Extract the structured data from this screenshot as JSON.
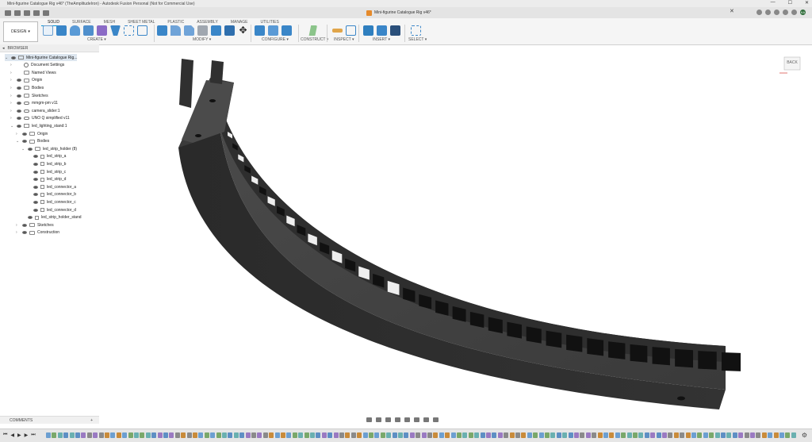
{
  "window": {
    "title": "Mini-figurine Catalogue Rig v46* (TheAmplitudeIron) - Autodesk Fusion Personal (Not for Commercial Use)",
    "controls": [
      "—",
      "☐",
      "✕"
    ]
  },
  "document_tab": {
    "title": "Mini-figurine Catalogue Rig v46*",
    "close": "✕",
    "account_initials": "KA"
  },
  "ribbon": {
    "workspace": "DESIGN",
    "tabs": [
      "SOLID",
      "SURFACE",
      "MESH",
      "SHEET METAL",
      "PLASTIC",
      "ASSEMBLY",
      "MANAGE",
      "UTILITIES"
    ],
    "active_tab": "SOLID",
    "groups": [
      "CREATE ▾",
      "MODIFY ▾",
      "CONFIGURE ▾",
      "CONSTRUCT ▾",
      "INSPECT ▾",
      "INSERT ▾",
      "SELECT ▾"
    ],
    "colors": {
      "accent": "#0696d7",
      "create": "#3a86c8",
      "insert": "#2f7fbf"
    }
  },
  "browser": {
    "title": "BROWSER",
    "items": [
      {
        "label": "Mini-figurine Catalogue Rig...",
        "level": 0,
        "kind": "root",
        "caret": "⌄",
        "eye": true
      },
      {
        "label": "Document Settings",
        "level": 1,
        "kind": "settings",
        "caret": "›",
        "eye": false
      },
      {
        "label": "Named Views",
        "level": 1,
        "kind": "folder",
        "caret": "›",
        "eye": false
      },
      {
        "label": "Origin",
        "level": 1,
        "kind": "folder",
        "caret": "›",
        "eye": true
      },
      {
        "label": "Bodies",
        "level": 1,
        "kind": "folder",
        "caret": "›",
        "eye": true
      },
      {
        "label": "Sketches",
        "level": 1,
        "kind": "folder",
        "caret": "›",
        "eye": true
      },
      {
        "label": "mmgm-pm v11",
        "level": 1,
        "kind": "link",
        "caret": "›",
        "eye": true
      },
      {
        "label": "camera_slider:1",
        "level": 1,
        "kind": "link",
        "caret": "›",
        "eye": true
      },
      {
        "label": "UNO Q simplified v11",
        "level": 1,
        "kind": "link",
        "caret": "›",
        "eye": true
      },
      {
        "label": "led_lighting_stand:1",
        "level": 1,
        "kind": "component",
        "caret": "⌄",
        "eye": true
      },
      {
        "label": "Origin",
        "level": 2,
        "kind": "folder",
        "caret": "›",
        "eye": true
      },
      {
        "label": "Bodies",
        "level": 2,
        "kind": "folder",
        "caret": "⌄",
        "eye": true
      },
      {
        "label": "led_strip_holder (8)",
        "level": 3,
        "kind": "folder",
        "caret": "⌄",
        "eye": true
      },
      {
        "label": "led_strip_a",
        "level": 4,
        "kind": "body",
        "caret": "",
        "eye": true
      },
      {
        "label": "led_strip_b",
        "level": 4,
        "kind": "body",
        "caret": "",
        "eye": true
      },
      {
        "label": "led_strip_c",
        "level": 4,
        "kind": "body",
        "caret": "",
        "eye": true
      },
      {
        "label": "led_strip_d",
        "level": 4,
        "kind": "body",
        "caret": "",
        "eye": true
      },
      {
        "label": "led_connector_a",
        "level": 4,
        "kind": "body",
        "caret": "",
        "eye": true
      },
      {
        "label": "led_connector_b",
        "level": 4,
        "kind": "body",
        "caret": "",
        "eye": true
      },
      {
        "label": "led_connector_c",
        "level": 4,
        "kind": "body",
        "caret": "",
        "eye": true
      },
      {
        "label": "led_connector_d",
        "level": 4,
        "kind": "body",
        "caret": "",
        "eye": true
      },
      {
        "label": "led_strip_holder_stand",
        "level": 3,
        "kind": "body",
        "caret": "",
        "eye": true
      },
      {
        "label": "Sketches",
        "level": 2,
        "kind": "folder",
        "caret": "›",
        "eye": true
      },
      {
        "label": "Construction",
        "level": 2,
        "kind": "folder",
        "caret": "›",
        "eye": true
      }
    ]
  },
  "viewcube": {
    "face": "BACK"
  },
  "comments": {
    "title": "COMMENTS",
    "add": "+"
  },
  "timeline": {
    "controls": [
      "⏮",
      "◀",
      "▶",
      "▶",
      "⏭"
    ],
    "settings": "⚙",
    "feature_colors": [
      "#6c9fd1",
      "#8a8a8a",
      "#5e8fc4",
      "#7aa86a",
      "#c98b3a",
      "#9a7ac2",
      "#6ab0b0"
    ]
  }
}
